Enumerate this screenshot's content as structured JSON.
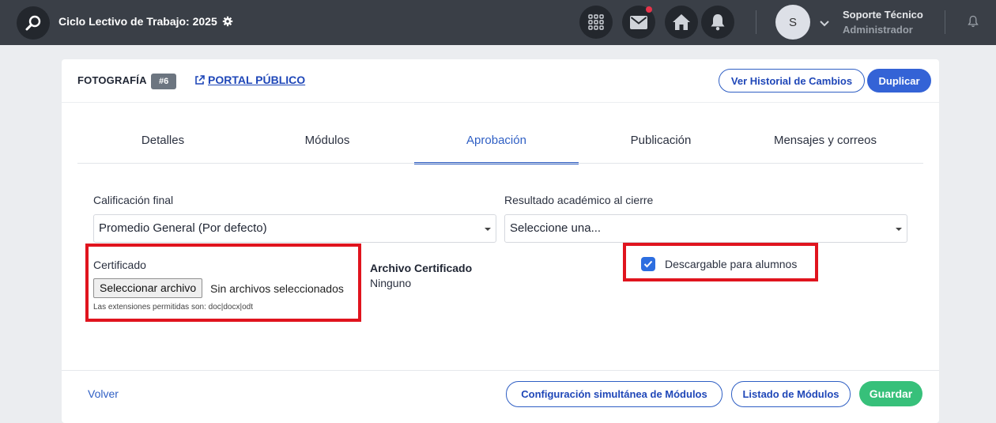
{
  "topbar": {
    "cycle_title": "Ciclo Lectivo de Trabajo: 2025",
    "user_name": "Soporte Técnico",
    "user_role": "Administrador",
    "avatar_initial": "S",
    "icons": [
      "search-icon",
      "gear-icon",
      "apps-grid-icon",
      "mail-icon",
      "home-icon",
      "bell-icon",
      "chevron-down-icon",
      "bell-outline-icon"
    ],
    "colors": {
      "bar": "#3a3f47",
      "notification_dot": "#e8334a"
    }
  },
  "header": {
    "title": "FOTOGRAFÍA",
    "badge": "#6",
    "portal_link": "PORTAL PÚBLICO",
    "history_button": "Ver Historial de Cambios",
    "duplicate_button": "Duplicar"
  },
  "tabs": [
    {
      "label": "Detalles",
      "active": false
    },
    {
      "label": "Módulos",
      "active": false
    },
    {
      "label": "Aprobación",
      "active": true
    },
    {
      "label": "Publicación",
      "active": false
    },
    {
      "label": "Mensajes y correos",
      "active": false
    }
  ],
  "form": {
    "final_grade_label": "Calificación final",
    "final_grade_value": "Promedio General (Por defecto)",
    "academic_result_label": "Resultado académico al cierre",
    "academic_result_value": "Seleccione una...",
    "certificate_label": "Certificado",
    "file_button": "Seleccionar archivo",
    "file_status": "Sin archivos seleccionados",
    "extensions_hint": "Las extensiones permitidas son: doc|docx|odt",
    "cert_file_title": "Archivo Certificado",
    "cert_file_value": "Ninguno",
    "downloadable_label": "Descargable para alumnos",
    "downloadable_checked": true
  },
  "footer": {
    "back_link": "Volver",
    "simultaneous_config_button": "Configuración simultánea de Módulos",
    "modules_list_button": "Listado de Módulos",
    "save_button": "Guardar"
  },
  "colors": {
    "accent": "#2f5fc4",
    "primary_button": "#3463d6",
    "save_button": "#37c07a",
    "highlight_box": "#e0141e"
  }
}
